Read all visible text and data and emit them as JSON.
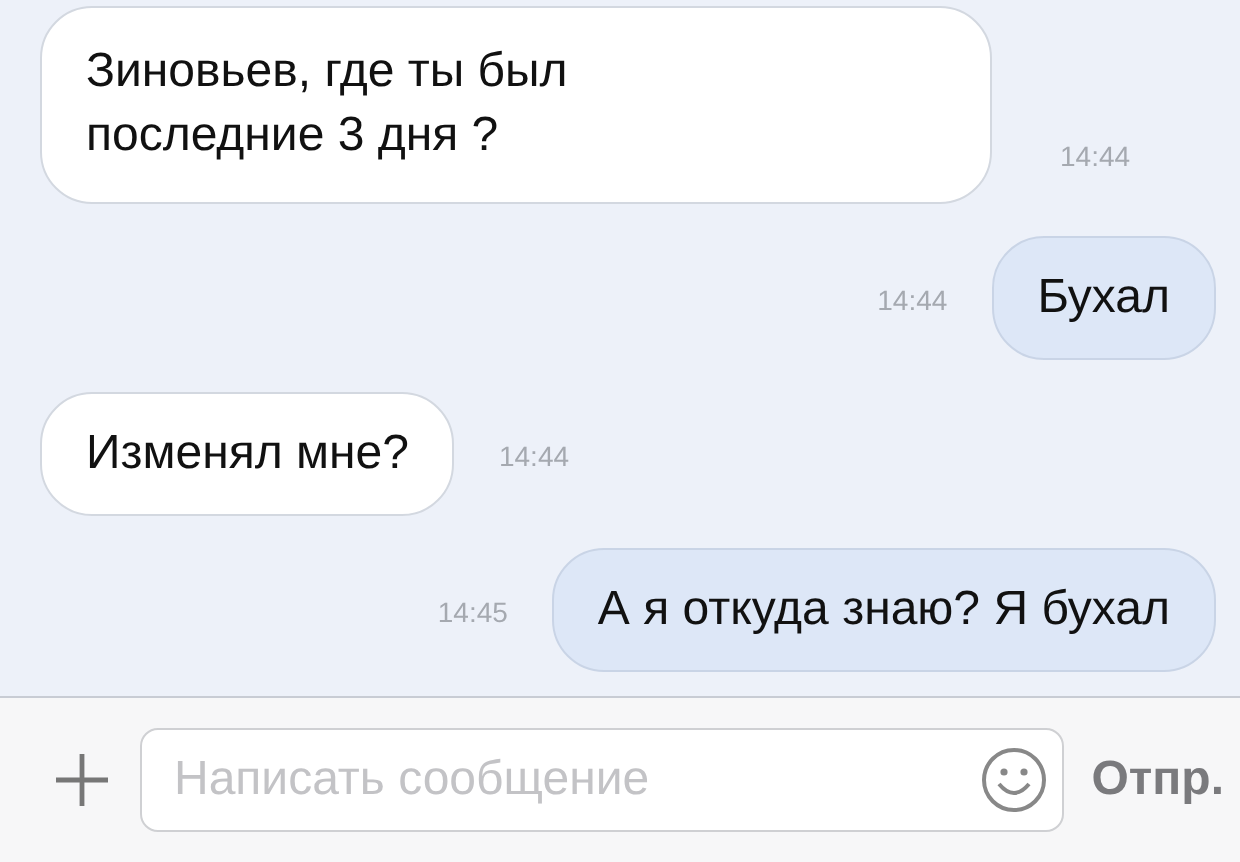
{
  "messages": [
    {
      "kind": "incoming",
      "text": "Зиновьев, где ты был\nпоследние 3 дня ?",
      "time": "14:44"
    },
    {
      "kind": "outgoing",
      "text": "Бухал",
      "time": "14:44"
    },
    {
      "kind": "incoming",
      "text": "Изменял мне?",
      "time": "14:44"
    },
    {
      "kind": "outgoing",
      "text": "А я откуда знаю? Я бухал",
      "time": "14:45"
    }
  ],
  "composer": {
    "placeholder": "Написать сообщение",
    "send": "Отпр."
  }
}
